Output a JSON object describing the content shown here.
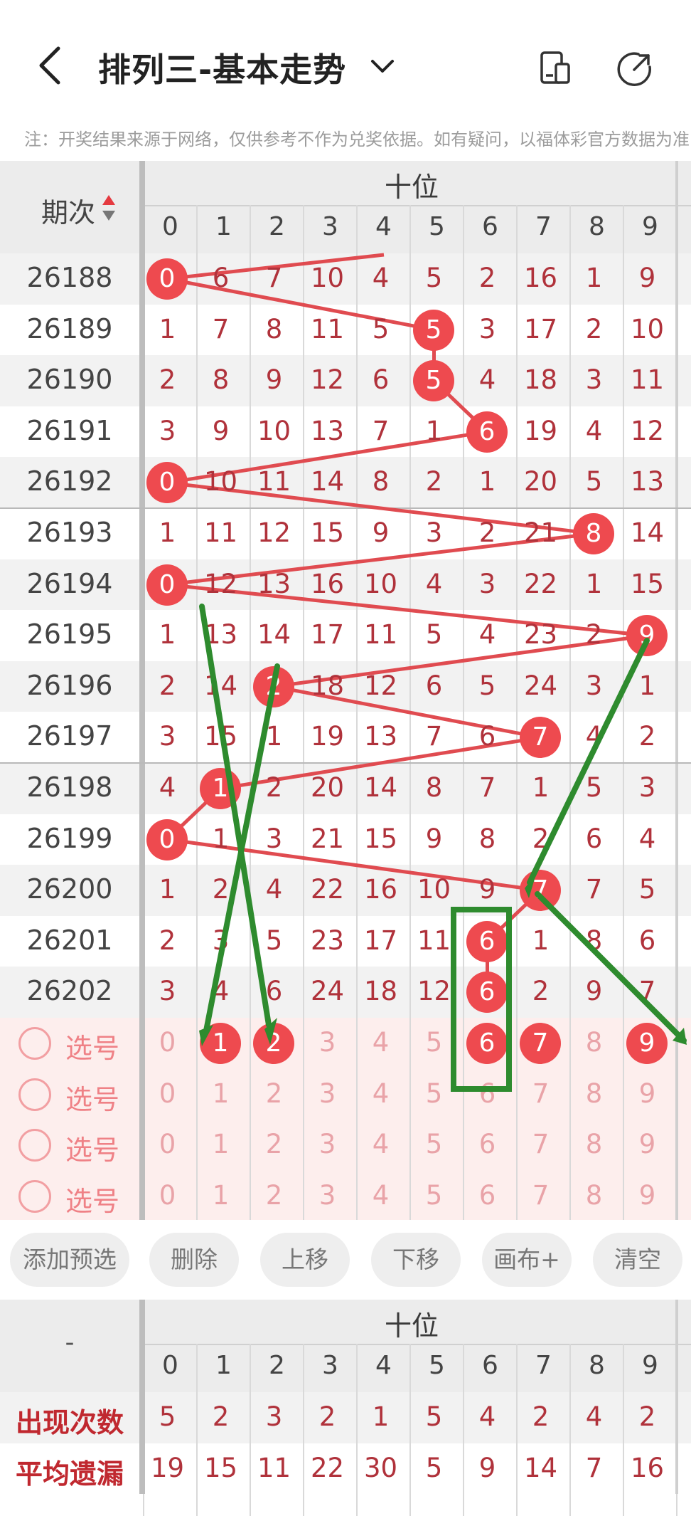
{
  "header": {
    "title": "排列三-基本走势",
    "notice": "注：开奖结果来源于网络，仅供参考不作为兑奖依据。如有疑问，以福体彩官方数据为准"
  },
  "trend": {
    "period_header": "期次",
    "group_title": "十位",
    "digits": [
      "0",
      "1",
      "2",
      "3",
      "4",
      "5",
      "6",
      "7",
      "8",
      "9"
    ],
    "rows": [
      {
        "period": "26188",
        "cells": [
          "0",
          "6",
          "7",
          "10",
          "4",
          "5",
          "2",
          "16",
          "1",
          "9"
        ],
        "hit": 0
      },
      {
        "period": "26189",
        "cells": [
          "1",
          "7",
          "8",
          "11",
          "5",
          "5",
          "3",
          "17",
          "2",
          "10"
        ],
        "hit": 5
      },
      {
        "period": "26190",
        "cells": [
          "2",
          "8",
          "9",
          "12",
          "6",
          "5",
          "4",
          "18",
          "3",
          "11"
        ],
        "hit": 5
      },
      {
        "period": "26191",
        "cells": [
          "3",
          "9",
          "10",
          "13",
          "7",
          "1",
          "6",
          "19",
          "4",
          "12"
        ],
        "hit": 6
      },
      {
        "period": "26192",
        "cells": [
          "0",
          "10",
          "11",
          "14",
          "8",
          "2",
          "1",
          "20",
          "5",
          "13"
        ],
        "hit": 0
      },
      {
        "period": "26193",
        "cells": [
          "1",
          "11",
          "12",
          "15",
          "9",
          "3",
          "2",
          "21",
          "8",
          "14"
        ],
        "hit": 8
      },
      {
        "period": "26194",
        "cells": [
          "0",
          "12",
          "13",
          "16",
          "10",
          "4",
          "3",
          "22",
          "1",
          "15"
        ],
        "hit": 0
      },
      {
        "period": "26195",
        "cells": [
          "1",
          "13",
          "14",
          "17",
          "11",
          "5",
          "4",
          "23",
          "2",
          "9"
        ],
        "hit": 9
      },
      {
        "period": "26196",
        "cells": [
          "2",
          "14",
          "2",
          "18",
          "12",
          "6",
          "5",
          "24",
          "3",
          "1"
        ],
        "hit": 2
      },
      {
        "period": "26197",
        "cells": [
          "3",
          "15",
          "1",
          "19",
          "13",
          "7",
          "6",
          "7",
          "4",
          "2"
        ],
        "hit": 7
      },
      {
        "period": "26198",
        "cells": [
          "4",
          "1",
          "2",
          "20",
          "14",
          "8",
          "7",
          "1",
          "5",
          "3"
        ],
        "hit": 1
      },
      {
        "period": "26199",
        "cells": [
          "0",
          "1",
          "3",
          "21",
          "15",
          "9",
          "8",
          "2",
          "6",
          "4"
        ],
        "hit": 0
      },
      {
        "period": "26200",
        "cells": [
          "1",
          "2",
          "4",
          "22",
          "16",
          "10",
          "9",
          "7",
          "7",
          "5"
        ],
        "hit": 7
      },
      {
        "period": "26201",
        "cells": [
          "2",
          "3",
          "5",
          "23",
          "17",
          "11",
          "6",
          "1",
          "8",
          "6"
        ],
        "hit": 6
      },
      {
        "period": "26202",
        "cells": [
          "3",
          "4",
          "6",
          "24",
          "18",
          "12",
          "6",
          "2",
          "9",
          "7"
        ],
        "hit": 6
      }
    ],
    "select_rows": [
      {
        "label": "选号",
        "selected": [
          1,
          2,
          6,
          7,
          9
        ]
      },
      {
        "label": "选号",
        "selected": []
      },
      {
        "label": "选号",
        "selected": []
      },
      {
        "label": "选号",
        "selected": []
      }
    ]
  },
  "actions": {
    "add": "添加预选",
    "delete": "删除",
    "up": "上移",
    "down": "下移",
    "canvas": "画布+",
    "clear": "清空"
  },
  "stats": {
    "left_header": "-",
    "group_title": "十位",
    "appear_label": "出现次数",
    "appear": [
      "5",
      "2",
      "3",
      "2",
      "1",
      "5",
      "4",
      "2",
      "4",
      "2"
    ],
    "avg_label": "平均遗漏",
    "avg": [
      "19",
      "15",
      "11",
      "22",
      "30",
      "5",
      "9",
      "14",
      "7",
      "16"
    ]
  },
  "colors": {
    "ball": "#ee4a4f",
    "miss_text": "#b0323b",
    "trend_line": "#e04b50",
    "annotation": "#2e8b2e"
  }
}
